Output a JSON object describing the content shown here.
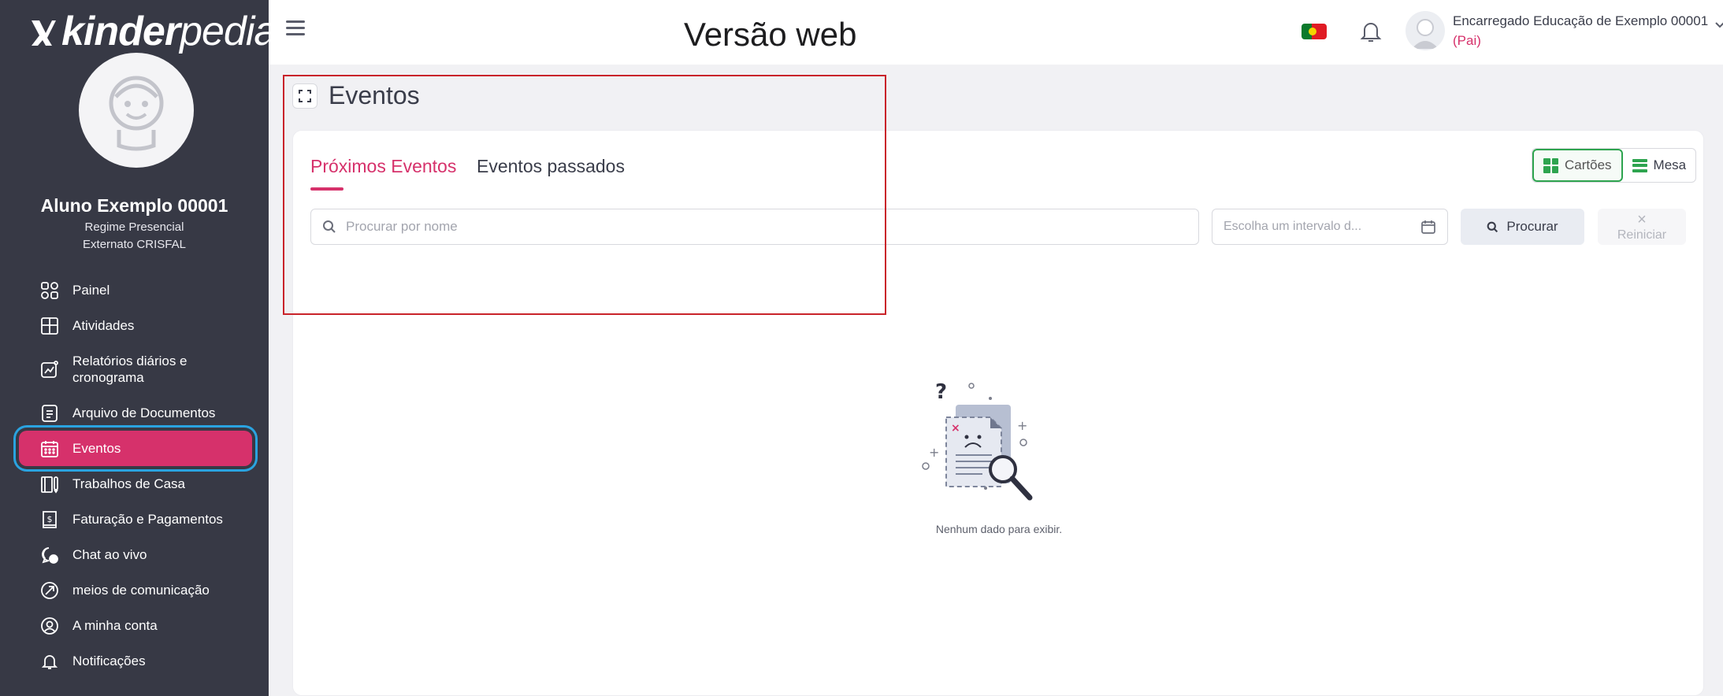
{
  "app": {
    "logo_mark": "ᚤ",
    "logo_bold": "kinder",
    "logo_light": "pedia",
    "version_title": "Versão web"
  },
  "student": {
    "name": "Aluno Exemplo 00001",
    "regime": "Regime Presencial",
    "school": "Externato CRISFAL"
  },
  "sidebar": {
    "items": [
      {
        "label": "Painel",
        "icon": "dashboard-icon"
      },
      {
        "label": "Atividades",
        "icon": "activities-icon"
      },
      {
        "label": "Relatórios diários e cronograma",
        "icon": "reports-icon"
      },
      {
        "label": "Arquivo de Documentos",
        "icon": "documents-icon"
      },
      {
        "label": "Eventos",
        "icon": "calendar-icon",
        "active": true
      },
      {
        "label": "Trabalhos de Casa",
        "icon": "homework-icon"
      },
      {
        "label": "Faturação e Pagamentos",
        "icon": "billing-icon"
      },
      {
        "label": "Chat ao vivo",
        "icon": "chat-icon"
      },
      {
        "label": "meios de comunicação",
        "icon": "media-icon"
      },
      {
        "label": "A minha conta",
        "icon": "account-icon"
      },
      {
        "label": "Notificações",
        "icon": "bell-icon"
      }
    ]
  },
  "header": {
    "user_name": "Encarregado Educação de Exemplo 00001",
    "user_role": "(Pai)",
    "language_flag": "portugal-flag-icon"
  },
  "page": {
    "title": "Eventos"
  },
  "tabs": {
    "upcoming": "Próximos Eventos",
    "past": "Eventos passados"
  },
  "view_toggle": {
    "cards": "Cartões",
    "table": "Mesa"
  },
  "filters": {
    "search_placeholder": "Procurar por nome",
    "date_placeholder": "Escolha um intervalo d...",
    "search_button": "Procurar",
    "reset_button": "Reiniciar"
  },
  "empty_state": {
    "message": "Nenhum dado para exibir."
  },
  "colors": {
    "sidebar_bg": "#373945",
    "accent": "#d6316b",
    "green": "#2ea44f",
    "annotation_red": "#c9232a",
    "annotation_blue": "#2aa3e0"
  }
}
